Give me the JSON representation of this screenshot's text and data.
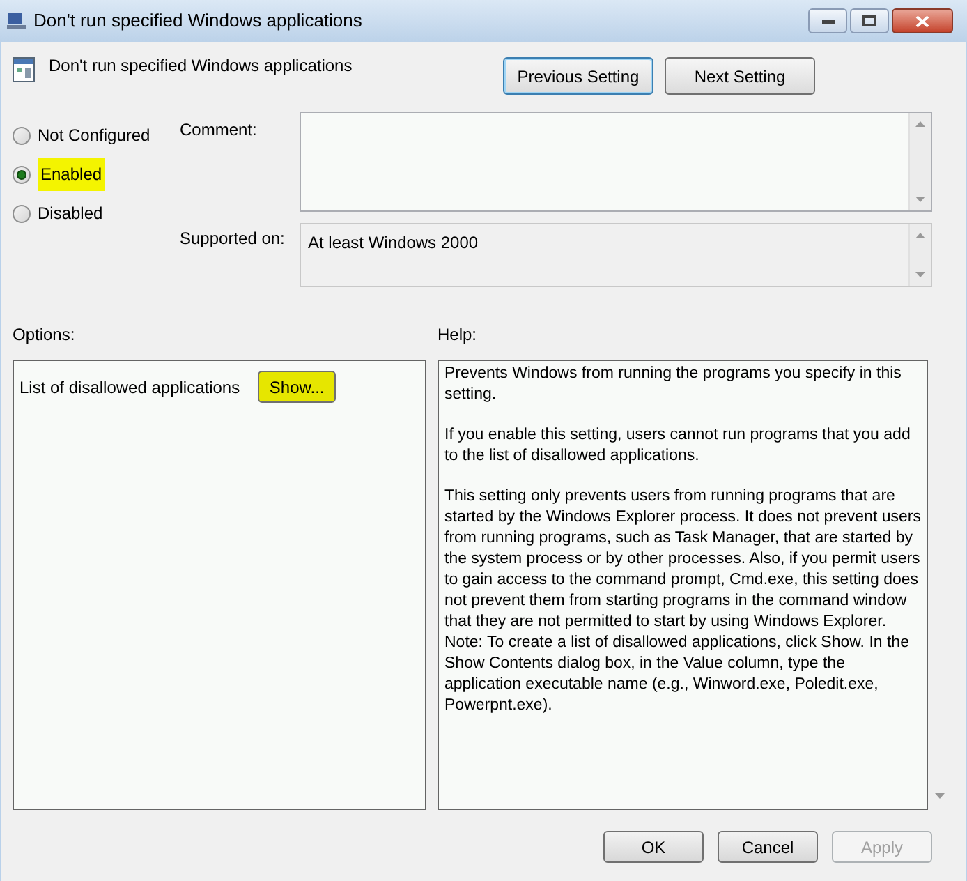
{
  "window": {
    "title": "Don't run specified Windows applications"
  },
  "header": {
    "policy_name": "Don't run specified Windows applications",
    "buttons": [
      {
        "label": "Previous Setting",
        "focused": true
      },
      {
        "label": "Next Setting",
        "focused": false
      }
    ]
  },
  "state_options": [
    {
      "label": "Not Configured",
      "selected": false,
      "highlighted": false
    },
    {
      "label": "Enabled",
      "selected": true,
      "highlighted": true
    },
    {
      "label": "Disabled",
      "selected": false,
      "highlighted": false
    }
  ],
  "comment": {
    "label": "Comment:"
  },
  "supported_on": {
    "label": "Supported on:",
    "value": "At least Windows 2000"
  },
  "options": {
    "label": "Options:",
    "items": [
      {
        "label": "List of disallowed applications",
        "button": "Show...",
        "highlighted": true
      }
    ]
  },
  "help": {
    "label": "Help:",
    "paragraphs": [
      "Prevents Windows from running the programs you specify in this setting.",
      "If you enable this setting, users cannot run programs that you add to the list of disallowed applications.",
      "This setting only prevents users from running programs that are started by the Windows Explorer process. It does not prevent users from running programs, such as Task Manager, that are started by the system process or by other processes. Also, if you permit users to gain access to the command prompt, Cmd.exe, this setting does not prevent them from starting programs in the command window that they are not permitted to start by using Windows Explorer. Note: To create a list of disallowed applications, click Show. In the Show Contents dialog box, in the Value column, type the application executable name (e.g., Winword.exe, Poledit.exe, Powerpnt.exe)."
    ]
  },
  "footer": {
    "buttons": [
      {
        "label": "OK",
        "disabled": false
      },
      {
        "label": "Cancel",
        "disabled": false
      },
      {
        "label": "Apply",
        "disabled": true
      }
    ]
  }
}
